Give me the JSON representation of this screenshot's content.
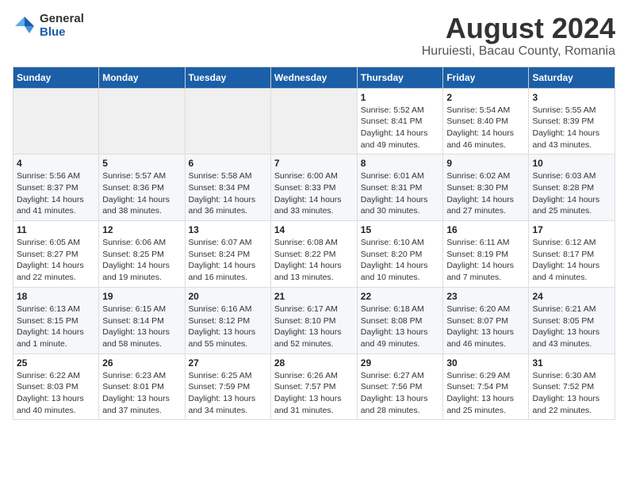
{
  "logo": {
    "general": "General",
    "blue": "Blue"
  },
  "title": "August 2024",
  "subtitle": "Huruiesti, Bacau County, Romania",
  "days_of_week": [
    "Sunday",
    "Monday",
    "Tuesday",
    "Wednesday",
    "Thursday",
    "Friday",
    "Saturday"
  ],
  "weeks": [
    [
      {
        "day": "",
        "info": ""
      },
      {
        "day": "",
        "info": ""
      },
      {
        "day": "",
        "info": ""
      },
      {
        "day": "",
        "info": ""
      },
      {
        "day": "1",
        "info": "Sunrise: 5:52 AM\nSunset: 8:41 PM\nDaylight: 14 hours and 49 minutes."
      },
      {
        "day": "2",
        "info": "Sunrise: 5:54 AM\nSunset: 8:40 PM\nDaylight: 14 hours and 46 minutes."
      },
      {
        "day": "3",
        "info": "Sunrise: 5:55 AM\nSunset: 8:39 PM\nDaylight: 14 hours and 43 minutes."
      }
    ],
    [
      {
        "day": "4",
        "info": "Sunrise: 5:56 AM\nSunset: 8:37 PM\nDaylight: 14 hours and 41 minutes."
      },
      {
        "day": "5",
        "info": "Sunrise: 5:57 AM\nSunset: 8:36 PM\nDaylight: 14 hours and 38 minutes."
      },
      {
        "day": "6",
        "info": "Sunrise: 5:58 AM\nSunset: 8:34 PM\nDaylight: 14 hours and 36 minutes."
      },
      {
        "day": "7",
        "info": "Sunrise: 6:00 AM\nSunset: 8:33 PM\nDaylight: 14 hours and 33 minutes."
      },
      {
        "day": "8",
        "info": "Sunrise: 6:01 AM\nSunset: 8:31 PM\nDaylight: 14 hours and 30 minutes."
      },
      {
        "day": "9",
        "info": "Sunrise: 6:02 AM\nSunset: 8:30 PM\nDaylight: 14 hours and 27 minutes."
      },
      {
        "day": "10",
        "info": "Sunrise: 6:03 AM\nSunset: 8:28 PM\nDaylight: 14 hours and 25 minutes."
      }
    ],
    [
      {
        "day": "11",
        "info": "Sunrise: 6:05 AM\nSunset: 8:27 PM\nDaylight: 14 hours and 22 minutes."
      },
      {
        "day": "12",
        "info": "Sunrise: 6:06 AM\nSunset: 8:25 PM\nDaylight: 14 hours and 19 minutes."
      },
      {
        "day": "13",
        "info": "Sunrise: 6:07 AM\nSunset: 8:24 PM\nDaylight: 14 hours and 16 minutes."
      },
      {
        "day": "14",
        "info": "Sunrise: 6:08 AM\nSunset: 8:22 PM\nDaylight: 14 hours and 13 minutes."
      },
      {
        "day": "15",
        "info": "Sunrise: 6:10 AM\nSunset: 8:20 PM\nDaylight: 14 hours and 10 minutes."
      },
      {
        "day": "16",
        "info": "Sunrise: 6:11 AM\nSunset: 8:19 PM\nDaylight: 14 hours and 7 minutes."
      },
      {
        "day": "17",
        "info": "Sunrise: 6:12 AM\nSunset: 8:17 PM\nDaylight: 14 hours and 4 minutes."
      }
    ],
    [
      {
        "day": "18",
        "info": "Sunrise: 6:13 AM\nSunset: 8:15 PM\nDaylight: 14 hours and 1 minute."
      },
      {
        "day": "19",
        "info": "Sunrise: 6:15 AM\nSunset: 8:14 PM\nDaylight: 13 hours and 58 minutes."
      },
      {
        "day": "20",
        "info": "Sunrise: 6:16 AM\nSunset: 8:12 PM\nDaylight: 13 hours and 55 minutes."
      },
      {
        "day": "21",
        "info": "Sunrise: 6:17 AM\nSunset: 8:10 PM\nDaylight: 13 hours and 52 minutes."
      },
      {
        "day": "22",
        "info": "Sunrise: 6:18 AM\nSunset: 8:08 PM\nDaylight: 13 hours and 49 minutes."
      },
      {
        "day": "23",
        "info": "Sunrise: 6:20 AM\nSunset: 8:07 PM\nDaylight: 13 hours and 46 minutes."
      },
      {
        "day": "24",
        "info": "Sunrise: 6:21 AM\nSunset: 8:05 PM\nDaylight: 13 hours and 43 minutes."
      }
    ],
    [
      {
        "day": "25",
        "info": "Sunrise: 6:22 AM\nSunset: 8:03 PM\nDaylight: 13 hours and 40 minutes."
      },
      {
        "day": "26",
        "info": "Sunrise: 6:23 AM\nSunset: 8:01 PM\nDaylight: 13 hours and 37 minutes."
      },
      {
        "day": "27",
        "info": "Sunrise: 6:25 AM\nSunset: 7:59 PM\nDaylight: 13 hours and 34 minutes."
      },
      {
        "day": "28",
        "info": "Sunrise: 6:26 AM\nSunset: 7:57 PM\nDaylight: 13 hours and 31 minutes."
      },
      {
        "day": "29",
        "info": "Sunrise: 6:27 AM\nSunset: 7:56 PM\nDaylight: 13 hours and 28 minutes."
      },
      {
        "day": "30",
        "info": "Sunrise: 6:29 AM\nSunset: 7:54 PM\nDaylight: 13 hours and 25 minutes."
      },
      {
        "day": "31",
        "info": "Sunrise: 6:30 AM\nSunset: 7:52 PM\nDaylight: 13 hours and 22 minutes."
      }
    ]
  ]
}
